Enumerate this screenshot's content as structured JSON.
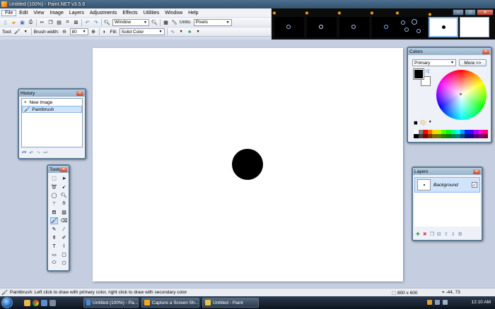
{
  "window": {
    "title": "Untitled (100%) - Paint.NET v3.5.6"
  },
  "menu": [
    "File",
    "Edit",
    "View",
    "Image",
    "Layers",
    "Adjustments",
    "Effects",
    "Utilities",
    "Window",
    "Help"
  ],
  "toolbar": {
    "zoom_value": "Window",
    "units_label": "Units:",
    "units_value": "Pixels",
    "tool_label": "Tool:",
    "brush_width_label": "Brush width:",
    "brush_width_value": "80",
    "fill_label": "Fill:",
    "fill_value": "Solid Color"
  },
  "history": {
    "title": "History",
    "items": [
      {
        "label": "New Image",
        "icon": "new-image-icon"
      },
      {
        "label": "Paintbrush",
        "icon": "paintbrush-icon"
      }
    ]
  },
  "tools": {
    "title": "Tools"
  },
  "colors": {
    "title": "Colors",
    "mode": "Primary",
    "more_button": "More >>",
    "primary_color": "#000000",
    "secondary_color": "#ffffff",
    "palette": [
      "#ffffff",
      "#808080",
      "#ff0000",
      "#ff6a00",
      "#ffd800",
      "#b6ff00",
      "#4cff00",
      "#00ff21",
      "#00ff90",
      "#00ffff",
      "#0094ff",
      "#0026ff",
      "#4800ff",
      "#b200ff",
      "#ff00dc",
      "#ff006e",
      "#000000",
      "#404040",
      "#7f0000",
      "#7f3300",
      "#7f6a00",
      "#5b7f00",
      "#267f00",
      "#007f0e",
      "#007f46",
      "#007f7f",
      "#004a7f",
      "#00137f",
      "#21007f",
      "#57007f",
      "#7f006e",
      "#7f0037"
    ]
  },
  "layers": {
    "title": "Layers",
    "items": [
      {
        "name": "Background",
        "visible": true
      }
    ]
  },
  "status": {
    "message": "Paintbrush: Left click to draw with primary color, right click to draw with secondary color",
    "image_size": "800 x 600",
    "cursor_pos": "-44, 73"
  },
  "taskbar": {
    "buttons": [
      {
        "label": "Untitled (100%) - Pa...",
        "icon_color": "#4a89dc"
      },
      {
        "label": "Capture a Screen Sh...",
        "icon_color": "#f5a623"
      },
      {
        "label": "Untitled - Paint",
        "icon_color": "#e8c34a"
      }
    ],
    "time": "12:10 AM"
  }
}
